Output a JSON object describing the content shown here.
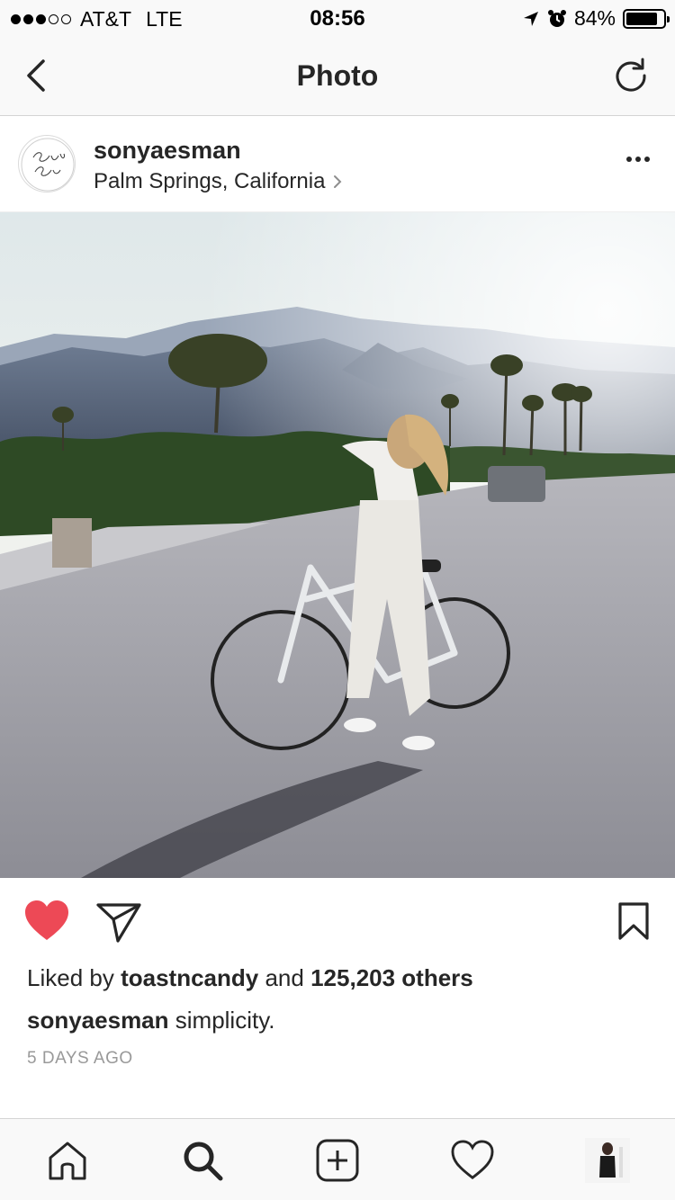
{
  "status_bar": {
    "carrier": "AT&T",
    "network": "LTE",
    "time": "08:56",
    "battery_percent": "84%",
    "battery_level": 0.84,
    "signal_bars_filled": 3,
    "signal_bars_total": 5
  },
  "nav": {
    "title": "Photo",
    "back_icon": "chevron-left-icon",
    "refresh_icon": "refresh-icon"
  },
  "post": {
    "username": "sonyaesman",
    "location": "Palm Springs, California",
    "avatar_text": "Sonya Esman",
    "likes": {
      "prefix": "Liked by",
      "liked_by_user": "toastncandy",
      "connector": "and",
      "others": "125,203 others"
    },
    "caption": {
      "username": "sonyaesman",
      "text": "simplicity."
    },
    "timestamp": "5 DAYS AGO",
    "liked": true
  },
  "colors": {
    "like_red": "#ed4956",
    "text_primary": "#262626",
    "text_secondary": "#999999",
    "bar_background": "#f9f9f9"
  },
  "tab_bar": {
    "items": [
      "home-icon",
      "search-icon",
      "add-post-icon",
      "activity-heart-icon",
      "profile-avatar"
    ]
  }
}
